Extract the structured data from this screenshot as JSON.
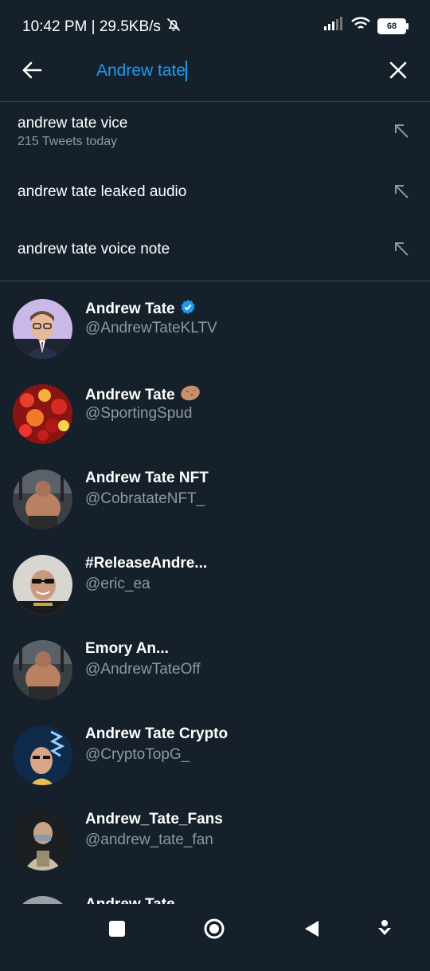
{
  "status": {
    "time_speed": "10:42 PM | 29.5KB/s",
    "battery": "68"
  },
  "search": {
    "value": "Andrew tate",
    "back_icon": "arrow-left-icon",
    "clear_icon": "close-icon"
  },
  "suggestions": [
    {
      "label": "andrew tate vice",
      "sub": "215 Tweets today"
    },
    {
      "label": "andrew tate leaked audio",
      "sub": ""
    },
    {
      "label": "andrew tate voice note",
      "sub": ""
    }
  ],
  "users": [
    {
      "name": "Andrew Tate",
      "handle": "@AndrewTateKLTV",
      "badge": "verified"
    },
    {
      "name": "Andrew Tate",
      "handle": "@SportingSpud",
      "badge": "potato-emoji"
    },
    {
      "name": "Andrew Tate NFT",
      "handle": "@CobratateNFT_",
      "badge": ""
    },
    {
      "name": "#ReleaseAndre...",
      "handle": "@eric_ea",
      "badge": ""
    },
    {
      "name": "Emory An...",
      "handle": "@AndrewTateOff",
      "badge": ""
    },
    {
      "name": "Andrew Tate Crypto",
      "handle": "@CryptoTopG_",
      "badge": ""
    },
    {
      "name": "Andrew_Tate_Fans",
      "handle": "@andrew_tate_fan",
      "badge": ""
    },
    {
      "name": "Andrew Tate",
      "handle": "",
      "badge": ""
    }
  ],
  "colors": {
    "background": "#15202b",
    "accent": "#1d9bf0",
    "secondary_text": "#8b98a5",
    "divider": "#38444d"
  }
}
